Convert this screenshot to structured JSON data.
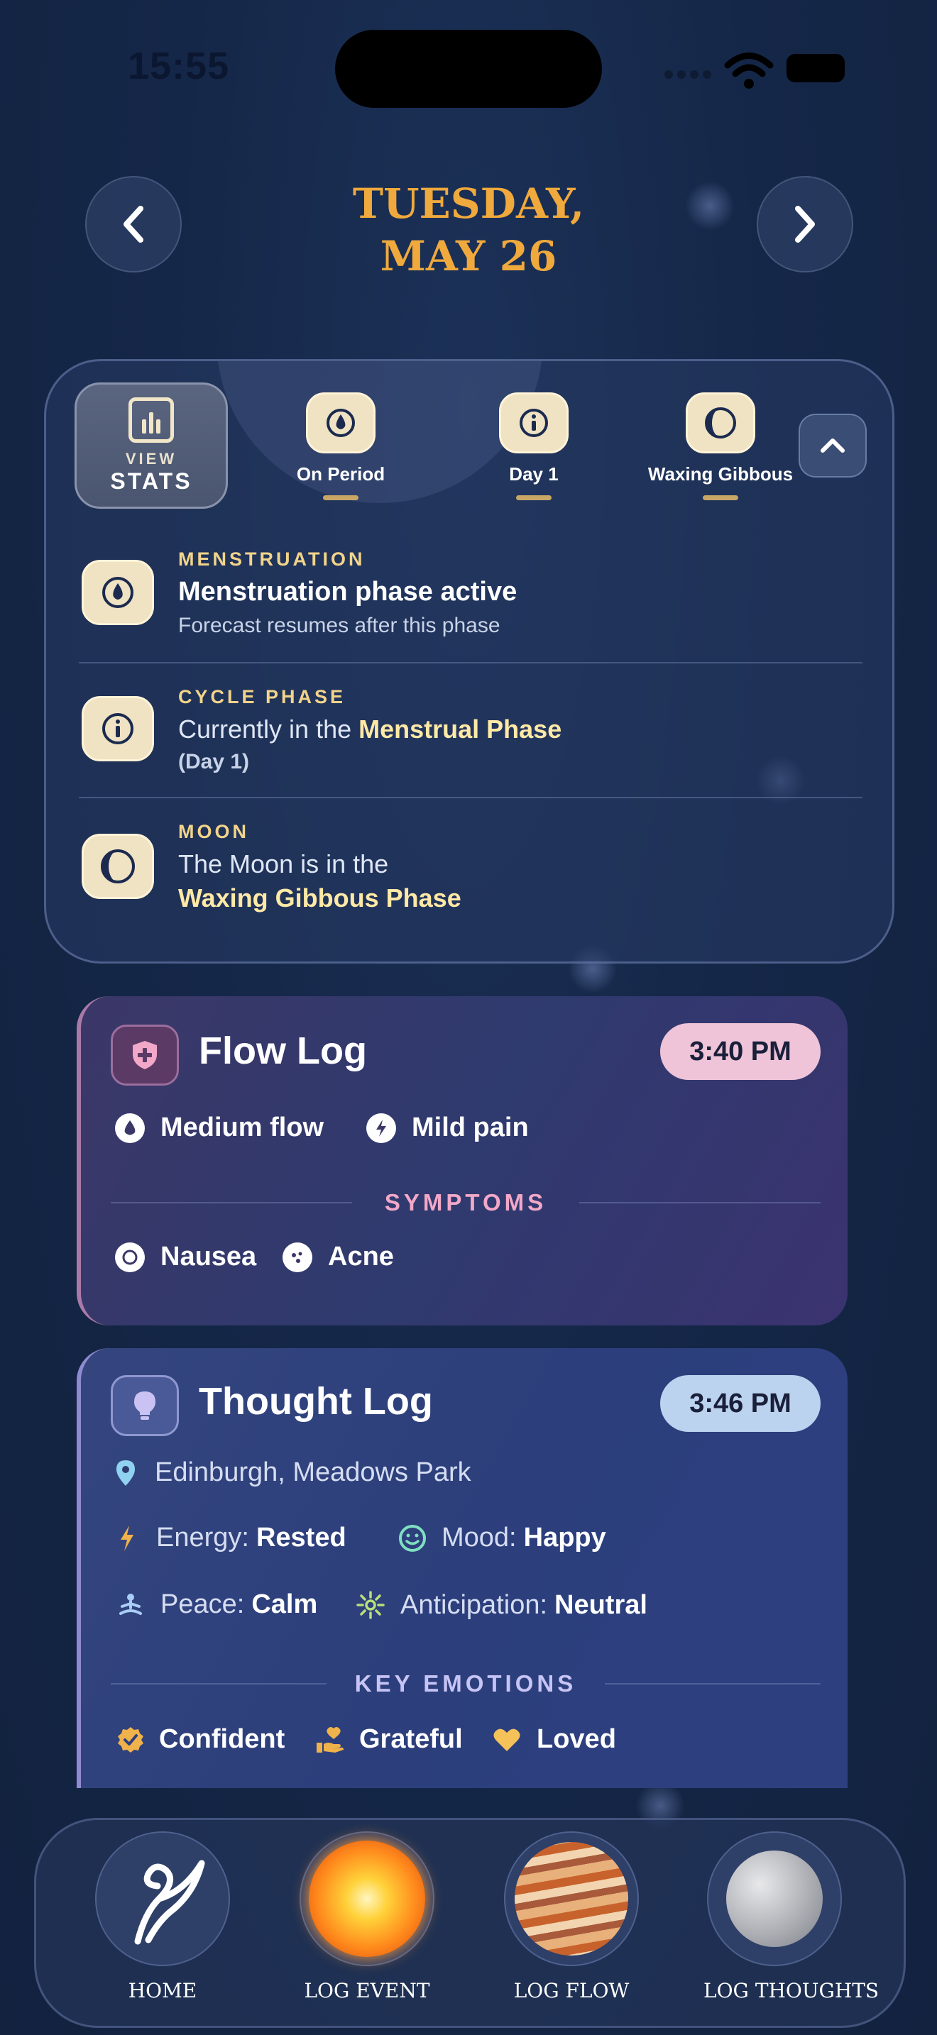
{
  "status_bar": {
    "time": "15:55"
  },
  "header": {
    "date_line1": "TUESDAY,",
    "date_line2": "MAY 26"
  },
  "summary": {
    "stats_button": {
      "small": "VIEW",
      "big": "STATS"
    },
    "chips": [
      {
        "label": "On Period",
        "icon": "drop-icon"
      },
      {
        "label": "Day 1",
        "icon": "info-icon"
      },
      {
        "label": "Waxing Gibbous",
        "icon": "moon-icon"
      }
    ],
    "rows": {
      "menstruation": {
        "kicker": "MENSTRUATION",
        "title": "Menstruation phase active",
        "sub": "Forecast resumes after this phase"
      },
      "cycle": {
        "kicker": "CYCLE PHASE",
        "text": "Currently in the",
        "highlight": "Menstrual Phase",
        "sub": "(Day 1)"
      },
      "moon": {
        "kicker": "MOON",
        "text": "The Moon is in the",
        "highlight": "Waxing Gibbous Phase"
      }
    }
  },
  "flow_log": {
    "title": "Flow Log",
    "time": "3:40 PM",
    "items": [
      "Medium flow",
      "Mild pain"
    ],
    "symptoms_label": "SYMPTOMS",
    "symptoms": [
      "Nausea",
      "Acne"
    ],
    "accent": "#f2a8c8"
  },
  "thought_log": {
    "title": "Thought Log",
    "time": "3:46 PM",
    "location": "Edinburgh, Meadows Park",
    "energy": {
      "label": "Energy:",
      "value": "Rested"
    },
    "mood": {
      "label": "Mood:",
      "value": "Happy"
    },
    "peace": {
      "label": "Peace:",
      "value": "Calm"
    },
    "anticipation": {
      "label": "Anticipation:",
      "value": "Neutral"
    },
    "emotions_label": "KEY EMOTIONS",
    "emotions": [
      "Confident",
      "Grateful",
      "Loved"
    ],
    "accent": "#b8b4f0"
  },
  "tabs": [
    {
      "label": "HOME",
      "icon": "swirl-icon"
    },
    {
      "label": "LOG EVENT",
      "icon": "sun-icon"
    },
    {
      "label": "LOG FLOW",
      "icon": "jupiter-icon"
    },
    {
      "label": "LOG THOUGHTS",
      "icon": "moon-planet-icon"
    }
  ]
}
